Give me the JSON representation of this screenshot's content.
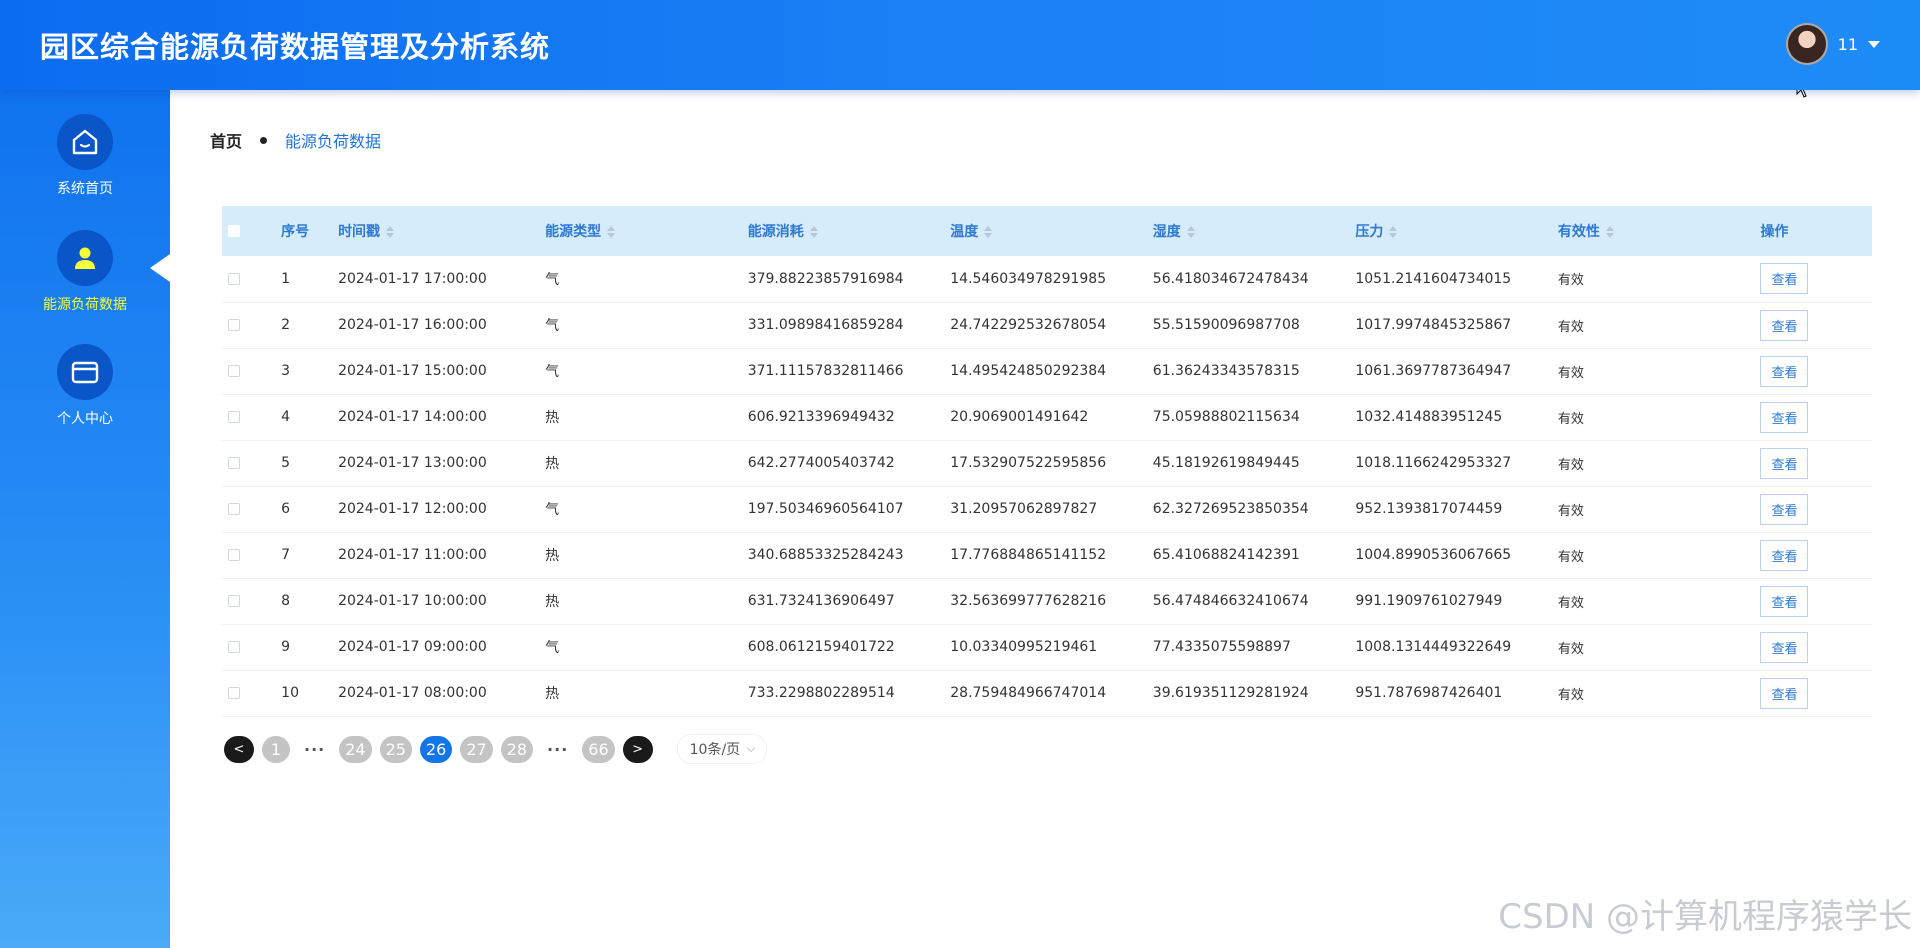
{
  "app": {
    "title": "园区综合能源负荷数据管理及分析系统"
  },
  "user": {
    "name": "11"
  },
  "sidebar": {
    "items": [
      {
        "label": "系统首页",
        "icon": "home-icon",
        "active": false
      },
      {
        "label": "能源负荷数据",
        "icon": "user-icon",
        "active": true
      },
      {
        "label": "个人中心",
        "icon": "card-icon",
        "active": false
      }
    ]
  },
  "breadcrumb": {
    "home": "首页",
    "current": "能源负荷数据"
  },
  "table": {
    "columns": [
      "序号",
      "时间戳",
      "能源类型",
      "能源消耗",
      "温度",
      "湿度",
      "压力",
      "有效性",
      "操作"
    ],
    "rows": [
      {
        "idx": "1",
        "time": "2024-01-17 17:00:00",
        "type": "气",
        "consumption": "379.88223857916984",
        "temp": "14.546034978291985",
        "humidity": "56.418034672478434",
        "pressure": "1051.2141604734015",
        "valid": "有效",
        "action": "查看"
      },
      {
        "idx": "2",
        "time": "2024-01-17 16:00:00",
        "type": "气",
        "consumption": "331.09898416859284",
        "temp": "24.742292532678054",
        "humidity": "55.51590096987708",
        "pressure": "1017.9974845325867",
        "valid": "有效",
        "action": "查看"
      },
      {
        "idx": "3",
        "time": "2024-01-17 15:00:00",
        "type": "气",
        "consumption": "371.11157832811466",
        "temp": "14.495424850292384",
        "humidity": "61.36243343578315",
        "pressure": "1061.3697787364947",
        "valid": "有效",
        "action": "查看"
      },
      {
        "idx": "4",
        "time": "2024-01-17 14:00:00",
        "type": "热",
        "consumption": "606.9213396949432",
        "temp": "20.9069001491642",
        "humidity": "75.05988802115634",
        "pressure": "1032.414883951245",
        "valid": "有效",
        "action": "查看"
      },
      {
        "idx": "5",
        "time": "2024-01-17 13:00:00",
        "type": "热",
        "consumption": "642.2774005403742",
        "temp": "17.532907522595856",
        "humidity": "45.18192619849445",
        "pressure": "1018.1166242953327",
        "valid": "有效",
        "action": "查看"
      },
      {
        "idx": "6",
        "time": "2024-01-17 12:00:00",
        "type": "气",
        "consumption": "197.50346960564107",
        "temp": "31.20957062897827",
        "humidity": "62.327269523850354",
        "pressure": "952.1393817074459",
        "valid": "有效",
        "action": "查看"
      },
      {
        "idx": "7",
        "time": "2024-01-17 11:00:00",
        "type": "热",
        "consumption": "340.68853325284243",
        "temp": "17.776884865141152",
        "humidity": "65.41068824142391",
        "pressure": "1004.8990536067665",
        "valid": "有效",
        "action": "查看"
      },
      {
        "idx": "8",
        "time": "2024-01-17 10:00:00",
        "type": "热",
        "consumption": "631.7324136906497",
        "temp": "32.563699777628216",
        "humidity": "56.474846632410674",
        "pressure": "991.1909761027949",
        "valid": "有效",
        "action": "查看"
      },
      {
        "idx": "9",
        "time": "2024-01-17 09:00:00",
        "type": "气",
        "consumption": "608.0612159401722",
        "temp": "10.03340995219461",
        "humidity": "77.4335075598897",
        "pressure": "1008.1314449322649",
        "valid": "有效",
        "action": "查看"
      },
      {
        "idx": "10",
        "time": "2024-01-17 08:00:00",
        "type": "热",
        "consumption": "733.2298802289514",
        "temp": "28.759484966747014",
        "humidity": "39.619351129281924",
        "pressure": "951.7876987426401",
        "valid": "有效",
        "action": "查看"
      }
    ]
  },
  "pagination": {
    "prev": "<",
    "next": ">",
    "ellipsis": "···",
    "pages": [
      "1",
      "24",
      "25",
      "26",
      "27",
      "28",
      "66"
    ],
    "current": "26",
    "page_size": "10条/页"
  },
  "watermark": "CSDN @计算机程序猿学长"
}
